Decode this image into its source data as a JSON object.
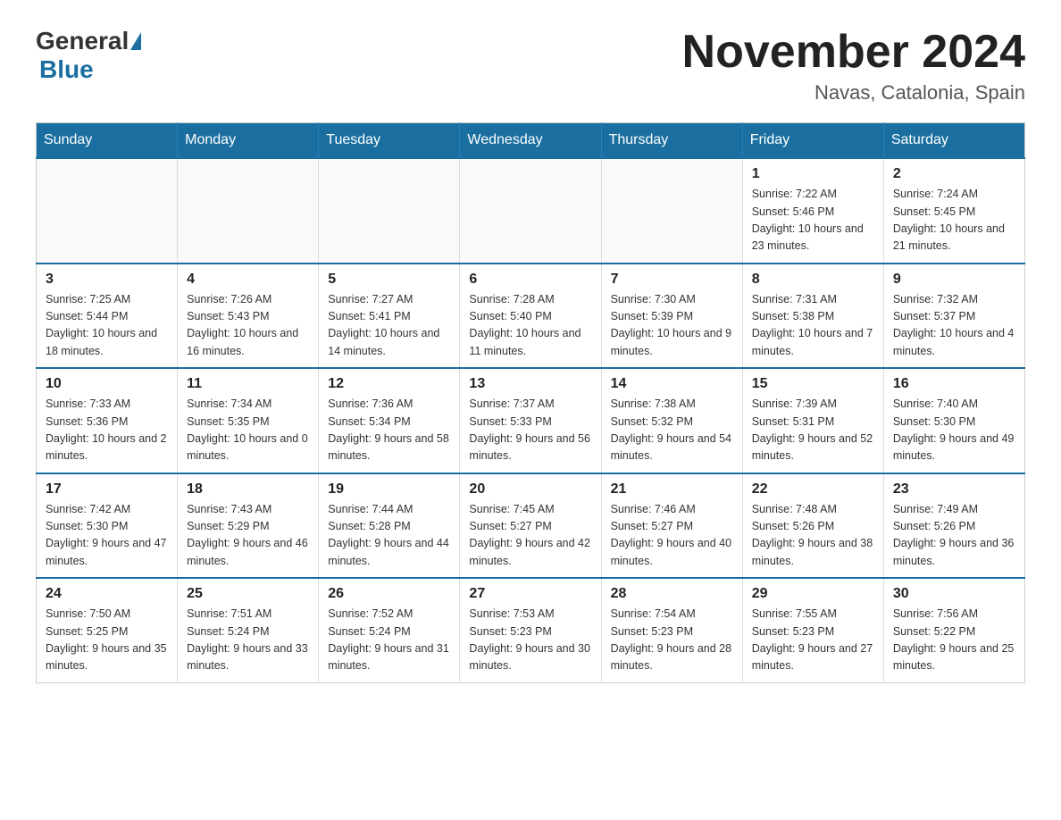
{
  "logo": {
    "general": "General",
    "blue": "Blue"
  },
  "title": {
    "month_year": "November 2024",
    "location": "Navas, Catalonia, Spain"
  },
  "weekdays": [
    "Sunday",
    "Monday",
    "Tuesday",
    "Wednesday",
    "Thursday",
    "Friday",
    "Saturday"
  ],
  "rows": [
    [
      {
        "day": "",
        "info": ""
      },
      {
        "day": "",
        "info": ""
      },
      {
        "day": "",
        "info": ""
      },
      {
        "day": "",
        "info": ""
      },
      {
        "day": "",
        "info": ""
      },
      {
        "day": "1",
        "info": "Sunrise: 7:22 AM\nSunset: 5:46 PM\nDaylight: 10 hours and 23 minutes."
      },
      {
        "day": "2",
        "info": "Sunrise: 7:24 AM\nSunset: 5:45 PM\nDaylight: 10 hours and 21 minutes."
      }
    ],
    [
      {
        "day": "3",
        "info": "Sunrise: 7:25 AM\nSunset: 5:44 PM\nDaylight: 10 hours and 18 minutes."
      },
      {
        "day": "4",
        "info": "Sunrise: 7:26 AM\nSunset: 5:43 PM\nDaylight: 10 hours and 16 minutes."
      },
      {
        "day": "5",
        "info": "Sunrise: 7:27 AM\nSunset: 5:41 PM\nDaylight: 10 hours and 14 minutes."
      },
      {
        "day": "6",
        "info": "Sunrise: 7:28 AM\nSunset: 5:40 PM\nDaylight: 10 hours and 11 minutes."
      },
      {
        "day": "7",
        "info": "Sunrise: 7:30 AM\nSunset: 5:39 PM\nDaylight: 10 hours and 9 minutes."
      },
      {
        "day": "8",
        "info": "Sunrise: 7:31 AM\nSunset: 5:38 PM\nDaylight: 10 hours and 7 minutes."
      },
      {
        "day": "9",
        "info": "Sunrise: 7:32 AM\nSunset: 5:37 PM\nDaylight: 10 hours and 4 minutes."
      }
    ],
    [
      {
        "day": "10",
        "info": "Sunrise: 7:33 AM\nSunset: 5:36 PM\nDaylight: 10 hours and 2 minutes."
      },
      {
        "day": "11",
        "info": "Sunrise: 7:34 AM\nSunset: 5:35 PM\nDaylight: 10 hours and 0 minutes."
      },
      {
        "day": "12",
        "info": "Sunrise: 7:36 AM\nSunset: 5:34 PM\nDaylight: 9 hours and 58 minutes."
      },
      {
        "day": "13",
        "info": "Sunrise: 7:37 AM\nSunset: 5:33 PM\nDaylight: 9 hours and 56 minutes."
      },
      {
        "day": "14",
        "info": "Sunrise: 7:38 AM\nSunset: 5:32 PM\nDaylight: 9 hours and 54 minutes."
      },
      {
        "day": "15",
        "info": "Sunrise: 7:39 AM\nSunset: 5:31 PM\nDaylight: 9 hours and 52 minutes."
      },
      {
        "day": "16",
        "info": "Sunrise: 7:40 AM\nSunset: 5:30 PM\nDaylight: 9 hours and 49 minutes."
      }
    ],
    [
      {
        "day": "17",
        "info": "Sunrise: 7:42 AM\nSunset: 5:30 PM\nDaylight: 9 hours and 47 minutes."
      },
      {
        "day": "18",
        "info": "Sunrise: 7:43 AM\nSunset: 5:29 PM\nDaylight: 9 hours and 46 minutes."
      },
      {
        "day": "19",
        "info": "Sunrise: 7:44 AM\nSunset: 5:28 PM\nDaylight: 9 hours and 44 minutes."
      },
      {
        "day": "20",
        "info": "Sunrise: 7:45 AM\nSunset: 5:27 PM\nDaylight: 9 hours and 42 minutes."
      },
      {
        "day": "21",
        "info": "Sunrise: 7:46 AM\nSunset: 5:27 PM\nDaylight: 9 hours and 40 minutes."
      },
      {
        "day": "22",
        "info": "Sunrise: 7:48 AM\nSunset: 5:26 PM\nDaylight: 9 hours and 38 minutes."
      },
      {
        "day": "23",
        "info": "Sunrise: 7:49 AM\nSunset: 5:26 PM\nDaylight: 9 hours and 36 minutes."
      }
    ],
    [
      {
        "day": "24",
        "info": "Sunrise: 7:50 AM\nSunset: 5:25 PM\nDaylight: 9 hours and 35 minutes."
      },
      {
        "day": "25",
        "info": "Sunrise: 7:51 AM\nSunset: 5:24 PM\nDaylight: 9 hours and 33 minutes."
      },
      {
        "day": "26",
        "info": "Sunrise: 7:52 AM\nSunset: 5:24 PM\nDaylight: 9 hours and 31 minutes."
      },
      {
        "day": "27",
        "info": "Sunrise: 7:53 AM\nSunset: 5:23 PM\nDaylight: 9 hours and 30 minutes."
      },
      {
        "day": "28",
        "info": "Sunrise: 7:54 AM\nSunset: 5:23 PM\nDaylight: 9 hours and 28 minutes."
      },
      {
        "day": "29",
        "info": "Sunrise: 7:55 AM\nSunset: 5:23 PM\nDaylight: 9 hours and 27 minutes."
      },
      {
        "day": "30",
        "info": "Sunrise: 7:56 AM\nSunset: 5:22 PM\nDaylight: 9 hours and 25 minutes."
      }
    ]
  ]
}
